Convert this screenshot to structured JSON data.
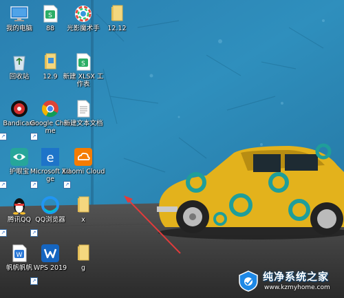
{
  "desktop": {
    "icons": [
      {
        "label": "我的电脑",
        "icon": "computer-icon"
      },
      {
        "label": "88",
        "icon": "wps-sheet-icon"
      },
      {
        "label": "光影魔术手",
        "icon": "photo-aperture-icon"
      },
      {
        "label": "12.12",
        "icon": "folder-icon"
      },
      {
        "label": "回收站",
        "icon": "recycle-bin-icon"
      },
      {
        "label": "12.9",
        "icon": "folder-icon"
      },
      {
        "label": "新建 XLSX 工作表",
        "icon": "wps-sheet-icon"
      },
      {
        "label": "Bandicam",
        "icon": "bandicam-icon"
      },
      {
        "label": "Google Chrome",
        "icon": "chrome-icon"
      },
      {
        "label": "新建文本文档",
        "icon": "text-document-icon"
      },
      {
        "label": "护眼宝",
        "icon": "eye-protect-icon"
      },
      {
        "label": "Microsoft Edge",
        "icon": "edge-icon"
      },
      {
        "label": "Xiaomi Cloud",
        "icon": "xiaomi-cloud-icon"
      },
      {
        "label": "腾讯QQ",
        "icon": "qq-penguin-icon"
      },
      {
        "label": "QQ浏览器",
        "icon": "qq-browser-icon"
      },
      {
        "label": "x",
        "icon": "folder-icon"
      },
      {
        "label": "帆帆帆帆",
        "icon": "word-document-icon"
      },
      {
        "label": "WPS 2019",
        "icon": "wps-icon"
      },
      {
        "label": "g",
        "icon": "folder-icon"
      }
    ]
  },
  "watermark": {
    "title": "纯净系统之家",
    "url": "www.kzmyhome.com"
  },
  "colors": {
    "wall_blue": "#2b86b3",
    "floor": "#3a3a3a",
    "car_yellow": "#e3b21c",
    "car_teal": "#1f9e9a",
    "arrow_red": "#e23b3b"
  }
}
